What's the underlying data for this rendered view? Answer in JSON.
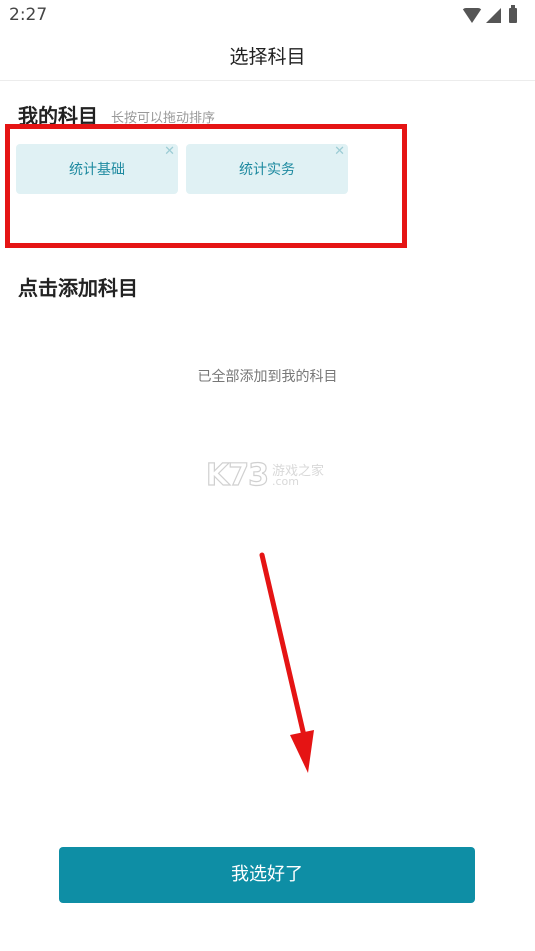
{
  "status_bar": {
    "time": "2:27"
  },
  "header": {
    "title": "选择科目"
  },
  "my_subjects": {
    "title": "我的科目",
    "hint": "长按可以拖动排序",
    "items": [
      {
        "label": "统计基础",
        "remove_glyph": "✕"
      },
      {
        "label": "统计实务",
        "remove_glyph": "✕"
      }
    ]
  },
  "add_subjects": {
    "title": "点击添加科目",
    "empty_message": "已全部添加到我的科目"
  },
  "watermark": {
    "logo_text": "K73",
    "cn_text": "游戏之家",
    "domain_text": ".com"
  },
  "footer": {
    "confirm_label": "我选好了"
  },
  "colors": {
    "accent": "#0e8ea5",
    "chip_bg": "#e0f1f4",
    "highlight": "#e51414"
  }
}
